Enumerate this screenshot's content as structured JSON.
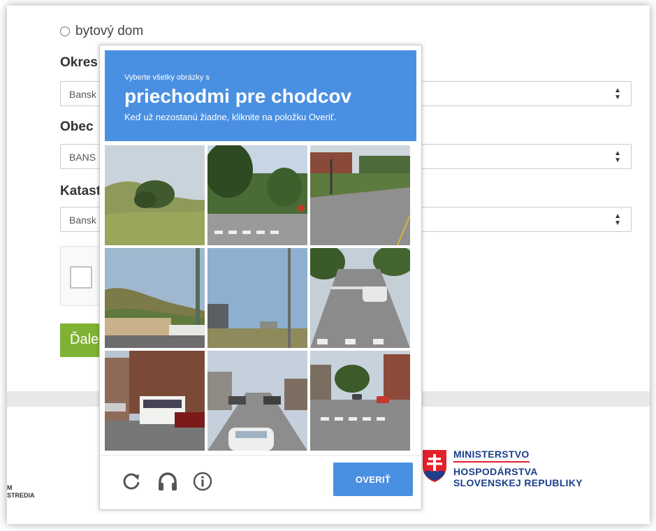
{
  "form": {
    "radio_label": "bytový dom",
    "okres_label": "Okres",
    "okres_value": "Bansk",
    "obec_label": "Obec",
    "obec_value": "BANS",
    "katastr_label": "Katast",
    "katastr_value": "Bansk",
    "next_label": "Ďale"
  },
  "footer": {
    "left_logo_line1": "M",
    "left_logo_line2": "STREDIA",
    "ministry_line1": "MINISTERSTVO",
    "ministry_line2": "HOSPODÁRSTVA",
    "ministry_line3": "SLOVENSKEJ REPUBLIKY"
  },
  "captcha": {
    "instruction_small": "Vyberte všetky obrázky s",
    "target": "priechodmi pre chodcov",
    "hint": "Keď už nezostanú žiadne, kliknite na položku Overiť.",
    "verify_label": "OVERIŤ",
    "header_color": "#4a90e2",
    "icons": [
      "reload-icon",
      "headphones-icon",
      "info-icon"
    ],
    "tiles": [
      {
        "name": "tile-hillside-tree"
      },
      {
        "name": "tile-intersection-trees"
      },
      {
        "name": "tile-street-fence"
      },
      {
        "name": "tile-hill-building-pole"
      },
      {
        "name": "tile-sky-streetlight"
      },
      {
        "name": "tile-street-crosswalk-car"
      },
      {
        "name": "tile-city-bus"
      },
      {
        "name": "tile-street-white-car"
      },
      {
        "name": "tile-intersection-crosswalk"
      }
    ]
  }
}
